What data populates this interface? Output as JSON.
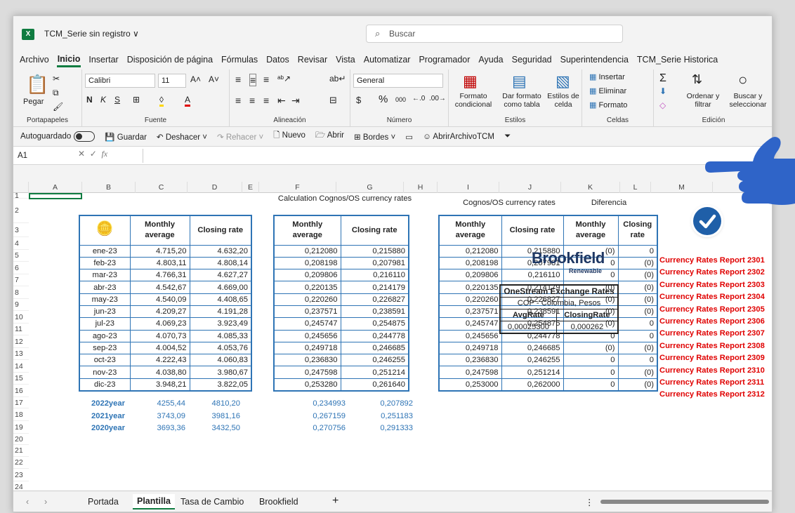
{
  "app": {
    "title": "TCM_Serie sin registro ∨",
    "search_placeholder": "Buscar",
    "menu": [
      "Archivo",
      "Inicio",
      "Insertar",
      "Disposición de página",
      "Fórmulas",
      "Datos",
      "Revisar",
      "Vista",
      "Automatizar",
      "Programador",
      "Ayuda",
      "Seguridad",
      "Superintendencia",
      "TCM_Serie Historica"
    ],
    "active_menu": "Inicio"
  },
  "ribbon": {
    "paste": "Pegar",
    "clipboard": "Portapapeles",
    "font_name": "Calibri",
    "font_size": "11",
    "font_group": "Fuente",
    "align_group": "Alineación",
    "number_format": "General",
    "number_group": "Número",
    "cond_format": "Formato condicional",
    "table_format": "Dar formato como tabla",
    "cell_styles": "Estilos de celda",
    "styles_group": "Estilos",
    "insert": "Insertar",
    "delete": "Eliminar",
    "format": "Formato",
    "cells_group": "Celdas",
    "sort": "Ordenar y filtrar",
    "find": "Buscar y seleccionar",
    "edit_group": "Edición"
  },
  "qat": {
    "autosave": "Autoguardado",
    "save": "Guardar",
    "undo": "Deshacer",
    "redo": "Rehacer",
    "new": "Nuevo",
    "open": "Abrir",
    "borders": "Bordes",
    "macro": "AbrirArchivoTCM"
  },
  "formula_bar": {
    "name_box": "A1",
    "fx": "fx"
  },
  "columns": [
    "A",
    "B",
    "C",
    "D",
    "E",
    "F",
    "G",
    "H",
    "I",
    "J",
    "K",
    "L",
    "M",
    "N"
  ],
  "rows": [
    "1",
    "2",
    "3",
    "4",
    "5",
    "6",
    "7",
    "8",
    "9",
    "10",
    "11",
    "12",
    "13",
    "14",
    "15",
    "16",
    "17",
    "18",
    "19",
    "20",
    "21",
    "22",
    "23",
    "24"
  ],
  "table1": {
    "headers": [
      "",
      "Monthly average",
      "Closing rate"
    ],
    "rows": [
      [
        "ene-23",
        "4.715,20",
        "4.632,20"
      ],
      [
        "feb-23",
        "4.803,11",
        "4.808,14"
      ],
      [
        "mar-23",
        "4.766,31",
        "4.627,27"
      ],
      [
        "abr-23",
        "4.542,67",
        "4.669,00"
      ],
      [
        "may-23",
        "4.540,09",
        "4.408,65"
      ],
      [
        "jun-23",
        "4.209,27",
        "4.191,28"
      ],
      [
        "jul-23",
        "4.069,23",
        "3.923,49"
      ],
      [
        "ago-23",
        "4.070,73",
        "4.085,33"
      ],
      [
        "sep-23",
        "4.004,52",
        "4.053,76"
      ],
      [
        "oct-23",
        "4.222,43",
        "4.060,83"
      ],
      [
        "nov-23",
        "4.038,80",
        "3.980,67"
      ],
      [
        "dic-23",
        "3.948,21",
        "3.822,05"
      ]
    ]
  },
  "table2": {
    "title": "Calculation Cognos/OS currency rates",
    "headers": [
      "Monthly average",
      "Closing rate"
    ],
    "rows": [
      [
        "0,212080",
        "0,215880"
      ],
      [
        "0,208198",
        "0,207981"
      ],
      [
        "0,209806",
        "0,216110"
      ],
      [
        "0,220135",
        "0,214179"
      ],
      [
        "0,220260",
        "0,226827"
      ],
      [
        "0,237571",
        "0,238591"
      ],
      [
        "0,245747",
        "0,254875"
      ],
      [
        "0,245656",
        "0,244778"
      ],
      [
        "0,249718",
        "0,246685"
      ],
      [
        "0,236830",
        "0,246255"
      ],
      [
        "0,247598",
        "0,251214"
      ],
      [
        "0,253280",
        "0,261640"
      ]
    ]
  },
  "table3": {
    "title": "Cognos/OS currency rates",
    "diff_title": "Diferencia",
    "headers": [
      "Monthly average",
      "Closing rate",
      "Monthly average",
      "Closing rate"
    ],
    "rows": [
      [
        "0,212080",
        "0,215880",
        "(0)",
        "0"
      ],
      [
        "0,208198",
        "0,207981",
        "0",
        "(0)"
      ],
      [
        "0,209806",
        "0,216110",
        "0",
        "(0)"
      ],
      [
        "0,220135",
        "0,214179",
        "(0)",
        "(0)"
      ],
      [
        "0,220260",
        "0,226827",
        "(0)",
        "(0)"
      ],
      [
        "0,237571",
        "0,238591",
        "(0)",
        "(0)"
      ],
      [
        "0,245747",
        "0,254875",
        "(0)",
        "0"
      ],
      [
        "0,245656",
        "0,244778",
        "0",
        "0"
      ],
      [
        "0,249718",
        "0,246685",
        "(0)",
        "(0)"
      ],
      [
        "0,236830",
        "0,246255",
        "0",
        "0"
      ],
      [
        "0,247598",
        "0,251214",
        "0",
        "(0)"
      ],
      [
        "0,253000",
        "0,262000",
        "0",
        "(0)"
      ]
    ]
  },
  "reports": [
    "Currency Rates Report 2301",
    "Currency Rates Report 2302",
    "Currency Rates Report 2303",
    "Currency Rates Report 2304",
    "Currency Rates Report 2305",
    "Currency Rates Report 2306",
    "Currency Rates Report 2307",
    "Currency Rates Report 2308",
    "Currency Rates Report 2309",
    "Currency Rates Report 2310",
    "Currency Rates Report 2311",
    "Currency Rates Report 2312"
  ],
  "yearly": [
    [
      "2022year",
      "4255,44",
      "4810,20",
      "0,234993",
      "0,207892"
    ],
    [
      "2021year",
      "3743,09",
      "3981,16",
      "0,267159",
      "0,251183"
    ],
    [
      "2020year",
      "3693,36",
      "3432,50",
      "0,270756",
      "0,291333"
    ]
  ],
  "brand": {
    "name": "Brookfield",
    "sub": "Renewable"
  },
  "onestream": {
    "title": "OneStream Exchange Rates",
    "subtitle": "COP - Colombia, Pesos",
    "headers": [
      "AvgRate",
      "ClosingRate"
    ],
    "values": [
      "0,00025300",
      "0,000262"
    ]
  },
  "sheet_tabs": [
    "Portada",
    "Plantilla",
    "Tasa de Cambio",
    "Brookfield"
  ],
  "active_tab": "Plantilla",
  "colors": {
    "accent": "#107c41",
    "table_border": "#2e74b5",
    "report_red": "#e00000",
    "year_blue": "#2e74b5"
  }
}
